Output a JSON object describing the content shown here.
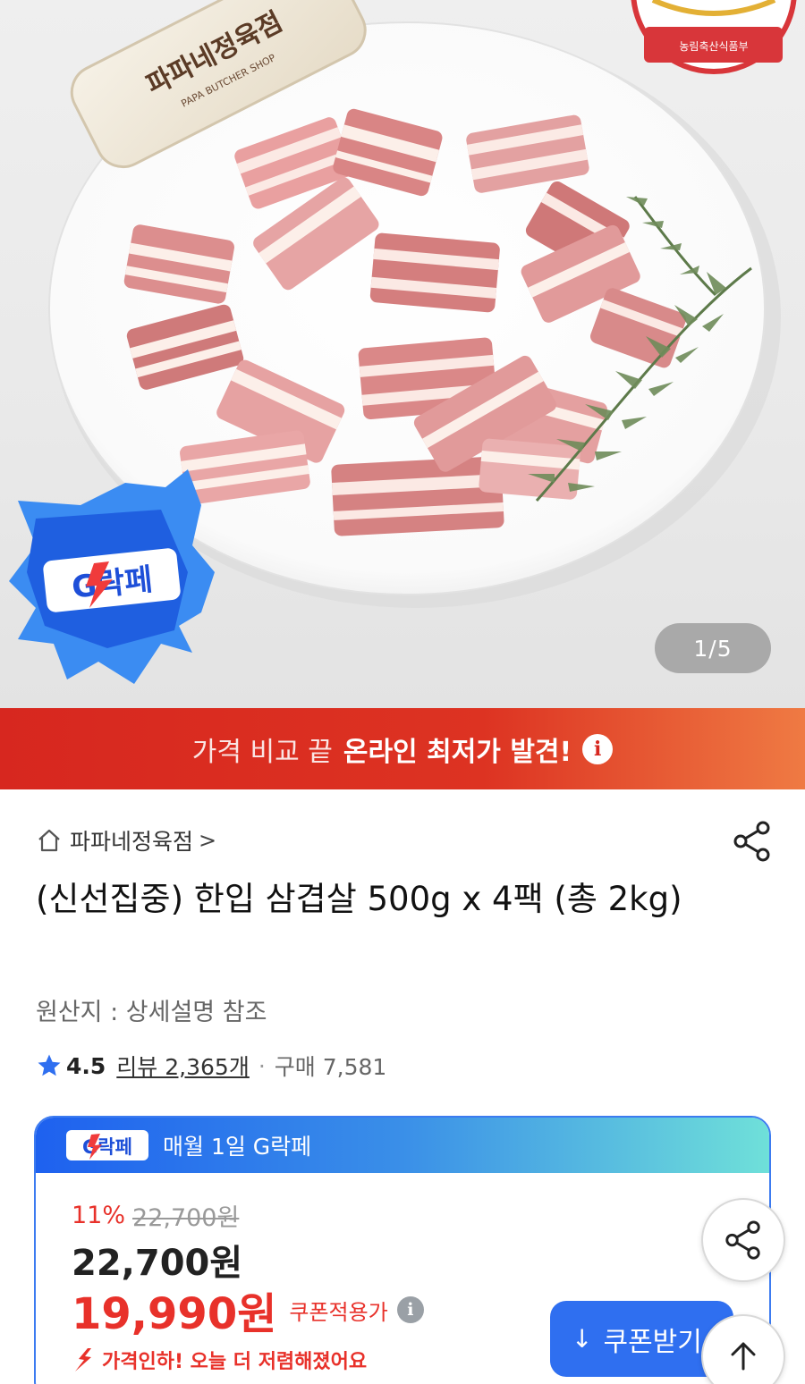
{
  "hero": {
    "page_counter": "1/5",
    "board_text": "파파네정육점",
    "board_sub": "PAPA BUTCHER SHOP",
    "seal_text": "농림축산식품부",
    "gbadge_text": "G락페"
  },
  "promo": {
    "light_text": "가격 비교 끝",
    "bold_text": "온라인 최저가 발견!",
    "info_icon": "i"
  },
  "store": {
    "name": "파파네정육점",
    "chevron": ">"
  },
  "product": {
    "title": "(신선집중) 한입 삼겹살 500g x 4팩 (총 2kg)",
    "origin": "원산지 : 상세설명 참조"
  },
  "rating": {
    "score": "4.5",
    "review": "리뷰 2,365개",
    "separator": "·",
    "purchases": "구매 7,581"
  },
  "price_card": {
    "header_badge": "G락페",
    "header_text": "매월 1일 G락페",
    "discount_pct": "11%",
    "original_price": "22,700원",
    "price": "22,700원",
    "coupon_price": "19,990원",
    "coupon_label": "쿠폰적용가",
    "info_icon": "i",
    "drop_text": "가격인하! 오늘 더 저렴해졌어요",
    "coupon_button": "쿠폰받기",
    "coupon_button_icon": "↓"
  },
  "colors": {
    "promo_red": "#d7271f",
    "accent_blue": "#2f6ff0",
    "sale_red": "#e8312a"
  }
}
